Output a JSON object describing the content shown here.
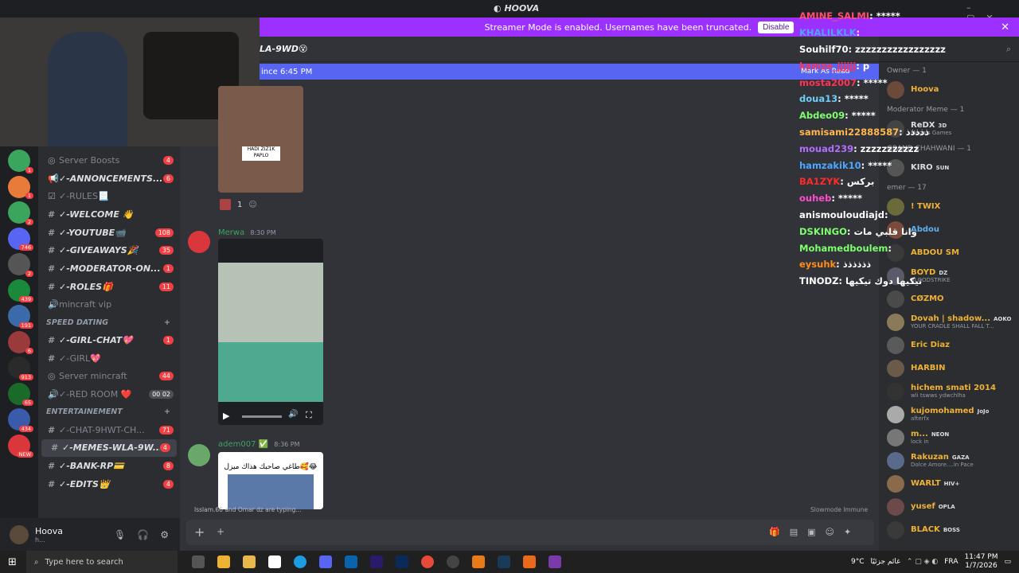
{
  "window": {
    "title": "HOOVA"
  },
  "banner": {
    "text": "Streamer Mode is enabled. Usernames have been truncated.",
    "button": "Disable"
  },
  "header": {
    "channel": "LA-9WD😵"
  },
  "newbar": {
    "text": "ince 6:45 PM",
    "mark": "Mark As Read"
  },
  "servers": {
    "badges": [
      "1",
      "1",
      "2",
      "746",
      "2",
      "439",
      "191",
      "6",
      "913",
      "65",
      "434",
      "NEW"
    ]
  },
  "channels": {
    "items": [
      {
        "type": "ch",
        "icon": "◎",
        "name": "Server Boosts",
        "badge": "4",
        "muted": true
      },
      {
        "type": "ch",
        "icon": "📢",
        "name": "✓-ANNONCEMENTS...",
        "badge": "6"
      },
      {
        "type": "ch",
        "icon": "☑",
        "name": "✓-RULES📃",
        "muted": true
      },
      {
        "type": "ch",
        "icon": "#",
        "name": "✓-WELCOME 👋"
      },
      {
        "type": "ch",
        "icon": "#",
        "name": "✓-YOUTUBE📹",
        "badge": "108"
      },
      {
        "type": "ch",
        "icon": "#",
        "name": "✓-GIVEAWAYS🎉",
        "badge": "35"
      },
      {
        "type": "ch",
        "icon": "#",
        "name": "✓-MODERATOR-ON...",
        "badge": "1"
      },
      {
        "type": "ch",
        "icon": "#",
        "name": "✓-ROLES🎁",
        "badge": "11"
      },
      {
        "type": "ch",
        "icon": "🔊",
        "name": "mincraft vip",
        "muted": true
      },
      {
        "type": "cat",
        "name": "SPEED DATING"
      },
      {
        "type": "ch",
        "icon": "#",
        "name": "✓-GIRL-CHAT💖",
        "badge": "1"
      },
      {
        "type": "ch",
        "icon": "#",
        "name": "✓-GIRL💖",
        "muted": true
      },
      {
        "type": "ch",
        "icon": "◎",
        "name": "Server mincraft",
        "badge": "44",
        "muted": true
      },
      {
        "type": "ch",
        "icon": "🔊",
        "name": "✓-RED ROOM ❤️",
        "badge": "00 02",
        "muted": true
      },
      {
        "type": "cat",
        "name": "ENTERTAINEMENT"
      },
      {
        "type": "ch",
        "icon": "#",
        "name": "✓-CHAT-9HWT-CH...",
        "badge": "71",
        "muted": true
      },
      {
        "type": "ch",
        "icon": "#",
        "name": "✓-MEMES-WLA-9W...",
        "badge": "4"
      },
      {
        "type": "ch",
        "icon": "#",
        "name": "✓-BANK-RP💳",
        "badge": "8"
      },
      {
        "type": "ch",
        "icon": "#",
        "name": "✓-EDITS👑",
        "badge": "4"
      }
    ]
  },
  "user": {
    "name": "Hoova",
    "status": "h..."
  },
  "messages": [
    {
      "author": "",
      "time": "",
      "reaction": "1",
      "caption": "HADI ZIZ1K PAPLO"
    },
    {
      "author": "Merwa",
      "time": "8:30 PM"
    },
    {
      "author": "adem007 ✅",
      "time": "8:36 PM",
      "caption": "طاغي صاحبك هذاك ميزل🥰😂"
    }
  ],
  "typing": {
    "text": "Isslam.66 and Omar dz are typing...",
    "slowmode": "Slowmode Immune"
  },
  "overlay": [
    {
      "name": "AMINE_SALMI",
      "msg": " : *****",
      "color": "#ff4d6d"
    },
    {
      "name": "KHALILKLK",
      "msg": " :",
      "color": "#4da6ff"
    },
    {
      "name": "Souhilf70",
      "msg": " : zzzzzzzzzzzzzzzzz",
      "color": "#ffffff"
    },
    {
      "name": "kamze_jjjjjj",
      "msg": " : p",
      "color": "#ff3355"
    },
    {
      "name": "mosta2007",
      "msg": " : *****",
      "color": "#ff3355"
    },
    {
      "name": "doua13",
      "msg": " : *****",
      "color": "#6dcff6"
    },
    {
      "name": "Abdeo09",
      "msg": " : *****",
      "color": "#7dff6d"
    },
    {
      "name": "samisami22888587",
      "msg": " : ذذذذذ",
      "color": "#ffb84d"
    },
    {
      "name": "mouad239",
      "msg": " : zzzzzzzzzzz",
      "color": "#b36dff"
    },
    {
      "name": "hamzakik10",
      "msg": " : *****",
      "color": "#4da6ff"
    },
    {
      "name": "BA1ZYK",
      "msg": " : بركس",
      "color": "#ff2a2a"
    },
    {
      "name": "ouheb",
      "msg": " : *****",
      "color": "#ff4dd2"
    },
    {
      "name": "anismouloudiajd",
      "msg": " :",
      "color": "#ffffff"
    },
    {
      "name": "DSKINGO",
      "msg": " : وانا قلبي مات",
      "color": "#7dff6d"
    },
    {
      "name": "Mohamedboulem",
      "msg": " :",
      "color": "#7dff6d"
    },
    {
      "name": "eysuhk",
      "msg": " : ذذذذذذ",
      "color": "#ff8c1a"
    },
    {
      "name": "TINODZ",
      "msg": " : تيكيها دوك تيكيها",
      "color": "#ffffff"
    }
  ],
  "members": {
    "groups": [
      {
        "label": "Owner — 1",
        "items": [
          {
            "name": "Hoova",
            "color": "#f0b232",
            "av": "#6b4a3a"
          }
        ]
      },
      {
        "label": "Moderator Meme — 1",
        "items": [
          {
            "name": "ReDX",
            "sub": "Mega's Games",
            "tag": "3D",
            "color": "#dbdee1",
            "av": "#444"
          }
        ]
      },
      {
        "label": "GRAND CHAHWANI — 1",
        "items": [
          {
            "name": "KIRO",
            "tag": "SUN",
            "color": "#dbdee1",
            "av": "#555"
          }
        ]
      },
      {
        "label": "emer — 17",
        "items": [
          {
            "name": "! TWIX",
            "color": "#f0b232",
            "av": "#6a6a3a"
          },
          {
            "name": "Abdou",
            "color": "#5eb0f0",
            "av": "#7a4a3a"
          },
          {
            "name": "ABDOU SM",
            "color": "#f0b232",
            "av": "#3a3a3a"
          },
          {
            "name": "BOYD",
            "sub": "BLOODSTRIKE",
            "tag": "DZ",
            "color": "#f0b232",
            "av": "#5a5a6a"
          },
          {
            "name": "CØZMÖ",
            "color": "#f0b232",
            "av": "#4a4a4a"
          },
          {
            "name": "Dovah | shadow...",
            "sub": "YOUR CRADLE SHALL FALL T...",
            "tag": "AOKO",
            "color": "#f0b232",
            "av": "#8a7a5a"
          },
          {
            "name": "Eric Diaz",
            "color": "#f0b232",
            "av": "#5a5a5a"
          },
          {
            "name": "HARBIN",
            "color": "#f0b232",
            "av": "#6a5a4a"
          },
          {
            "name": "hichem smati 2014",
            "sub": "wli tswws ydwchlha",
            "color": "#f0b232",
            "av": "#333"
          },
          {
            "name": "kujomohamed",
            "sub": "afterfx",
            "tag": "JoJo",
            "color": "#f0b232",
            "av": "#aaa"
          },
          {
            "name": "m...",
            "sub": "lock in",
            "tag": "NEON",
            "color": "#f0b232",
            "av": "#777"
          },
          {
            "name": "Rakuzan",
            "sub": "Dolce Amore....in Pace",
            "tag": "GAZA",
            "color": "#f0b232",
            "av": "#5a6a8a"
          },
          {
            "name": "WARLT",
            "tag": "HIV+",
            "color": "#f0b232",
            "av": "#8a6a4a"
          },
          {
            "name": "yusef",
            "tag": "OPLA",
            "color": "#f0b232",
            "av": "#6a4a4a"
          },
          {
            "name": "BLACK",
            "tag": "BOSS",
            "color": "#f0b232",
            "av": "#3a3a3a"
          }
        ]
      }
    ]
  },
  "taskbar": {
    "search": "Type here to search",
    "weather": "9°C",
    "weather_text": "غائم جزئيًا",
    "lang": "FRA",
    "time": "11:47 PM",
    "date": "1/7/2026"
  }
}
